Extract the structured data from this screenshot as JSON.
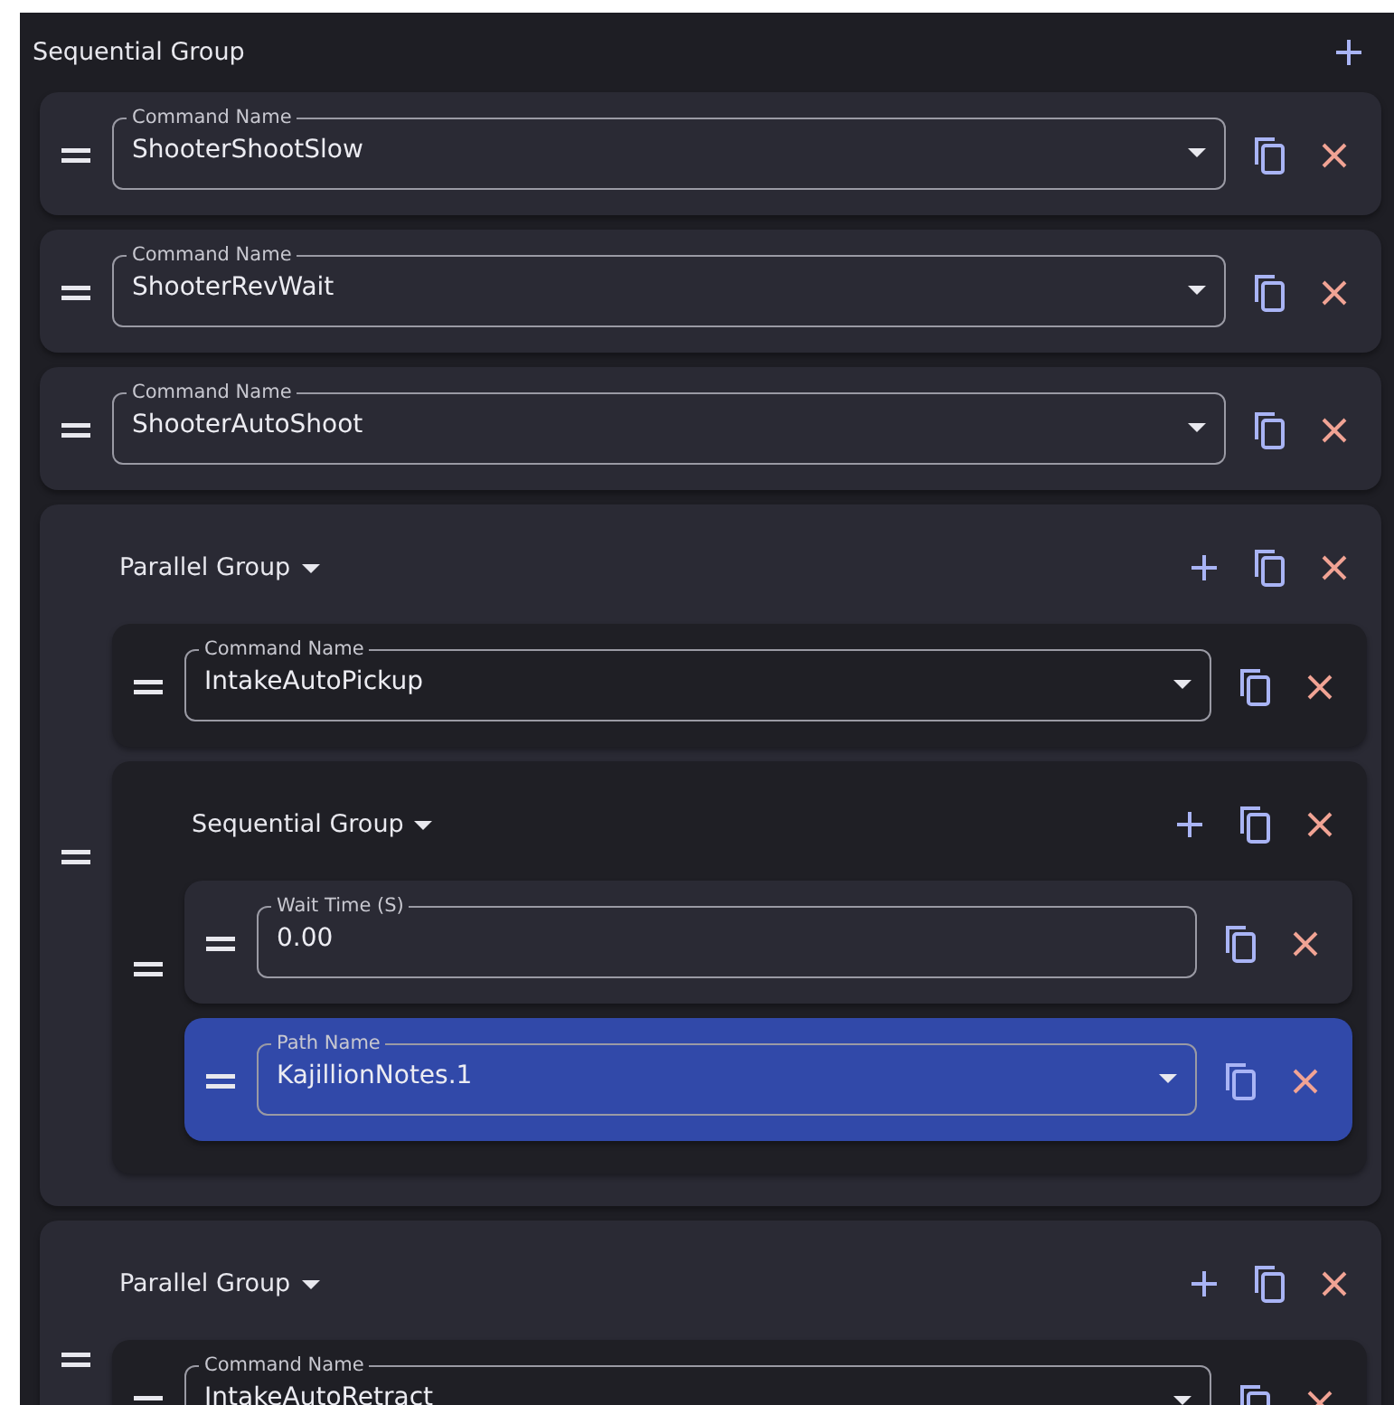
{
  "root": {
    "title": "Sequential Group",
    "children": [
      {
        "kind": "command",
        "selected": false,
        "field": {
          "label": "Command Name",
          "value": "ShooterShootSlow"
        }
      },
      {
        "kind": "command",
        "selected": false,
        "field": {
          "label": "Command Name",
          "value": "ShooterRevWait"
        }
      },
      {
        "kind": "command",
        "selected": false,
        "field": {
          "label": "Command Name",
          "value": "ShooterAutoShoot"
        }
      },
      {
        "kind": "group",
        "selected": false,
        "title": "Parallel Group",
        "children": [
          {
            "kind": "command",
            "selected": false,
            "field": {
              "label": "Command Name",
              "value": "IntakeAutoPickup"
            }
          },
          {
            "kind": "group",
            "selected": false,
            "title": "Sequential Group",
            "children": [
              {
                "kind": "wait",
                "selected": false,
                "field": {
                  "label": "Wait Time (S)",
                  "value": "0.00"
                }
              },
              {
                "kind": "path",
                "selected": true,
                "field": {
                  "label": "Path Name",
                  "value": "KajillionNotes.1"
                }
              }
            ]
          }
        ]
      },
      {
        "kind": "group",
        "selected": false,
        "title": "Parallel Group",
        "children": [
          {
            "kind": "command",
            "selected": false,
            "field": {
              "label": "Command Name",
              "value": "IntakeAutoRetract"
            }
          }
        ]
      }
    ]
  }
}
